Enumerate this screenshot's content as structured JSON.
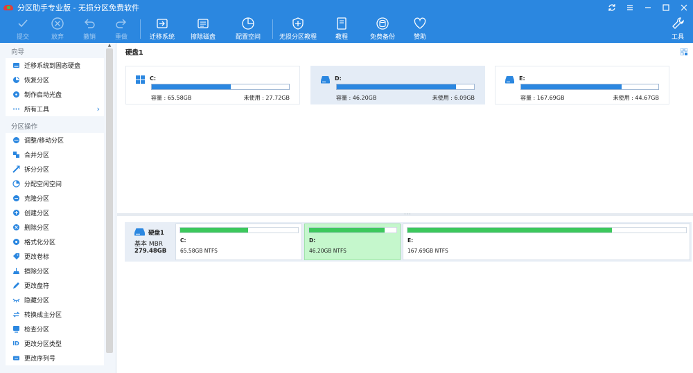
{
  "window": {
    "title": "分区助手专业版 - 无损分区免费软件"
  },
  "toolbar": [
    {
      "id": "commit",
      "label": "提交",
      "icon": "check-icon",
      "enabled": false
    },
    {
      "id": "discard",
      "label": "放弃",
      "icon": "cancel-circle-icon",
      "enabled": false
    },
    {
      "id": "undo",
      "label": "撤销",
      "icon": "undo-icon",
      "enabled": false
    },
    {
      "id": "redo",
      "label": "重做",
      "icon": "redo-icon",
      "enabled": false
    },
    {
      "id": "migrate",
      "label": "迁移系统",
      "icon": "migrate-drive-icon",
      "enabled": true
    },
    {
      "id": "wipe",
      "label": "擦除磁盘",
      "icon": "wipe-disk-icon",
      "enabled": true
    },
    {
      "id": "allocate",
      "label": "配置空间",
      "icon": "pie-chart-icon",
      "enabled": true
    },
    {
      "id": "tutorial-lossless",
      "label": "无损分区教程",
      "icon": "shield-plus-icon",
      "enabled": true
    },
    {
      "id": "tutorial",
      "label": "教程",
      "icon": "book-icon",
      "enabled": true
    },
    {
      "id": "backup",
      "label": "免费备份",
      "icon": "backup-disk-icon",
      "enabled": true
    },
    {
      "id": "donate",
      "label": "赞助",
      "icon": "heart-icon",
      "enabled": true
    },
    {
      "id": "tools",
      "label": "工具",
      "icon": "wrench-icon",
      "enabled": true
    }
  ],
  "sidebar": {
    "wizard_title": "向导",
    "wizard_items": [
      {
        "label": "迁移系统到固态硬盘",
        "icon": "ssd-migrate-icon"
      },
      {
        "label": "恢复分区",
        "icon": "recover-partition-icon"
      },
      {
        "label": "制作启动光盘",
        "icon": "bootable-disc-icon"
      },
      {
        "label": "所有工具",
        "icon": "more-dots-icon",
        "chevron": "›"
      }
    ],
    "ops_title": "分区操作",
    "ops_items": [
      {
        "label": "调整/移动分区",
        "icon": "resize-partition-icon"
      },
      {
        "label": "合并分区",
        "icon": "merge-partition-icon"
      },
      {
        "label": "拆分分区",
        "icon": "split-partition-icon"
      },
      {
        "label": "分配空闲空间",
        "icon": "allocate-space-icon"
      },
      {
        "label": "克隆分区",
        "icon": "clone-partition-icon"
      },
      {
        "label": "创建分区",
        "icon": "create-partition-icon"
      },
      {
        "label": "删除分区",
        "icon": "delete-partition-icon"
      },
      {
        "label": "格式化分区",
        "icon": "format-partition-icon"
      },
      {
        "label": "更改卷标",
        "icon": "tag-icon"
      },
      {
        "label": "擦除分区",
        "icon": "wipe-partition-icon"
      },
      {
        "label": "更改盘符",
        "icon": "pencil-icon"
      },
      {
        "label": "隐藏分区",
        "icon": "hide-eye-icon"
      },
      {
        "label": "转换成主分区",
        "icon": "convert-icon"
      },
      {
        "label": "检查分区",
        "icon": "check-partition-icon"
      },
      {
        "label": "更改分区类型",
        "icon": "id-icon",
        "icon_text": "ID"
      },
      {
        "label": "更改序列号",
        "icon": "serial-number-icon"
      }
    ]
  },
  "disk_panel": {
    "title": "硬盘1",
    "volumes": [
      {
        "name": "C:",
        "capacity": "容量 : 65.58GB",
        "free": "未使用 : 27.72GB",
        "used_fraction": 0.577,
        "selected": false,
        "icon": "windows-logo-icon"
      },
      {
        "name": "D:",
        "capacity": "容量 : 46.20GB",
        "free": "未使用 : 6.09GB",
        "used_fraction": 0.868,
        "selected": true,
        "icon": "drive-icon"
      },
      {
        "name": "E:",
        "capacity": "容量 : 167.69GB",
        "free": "未使用 : 44.67GB",
        "used_fraction": 0.734,
        "selected": false,
        "icon": "drive-icon"
      }
    ]
  },
  "disk_map": {
    "disk_name": "硬盘1",
    "disk_type": "基本 MBR",
    "disk_size": "279.48GB",
    "partitions": [
      {
        "name": "C:",
        "desc": "65.58GB NTFS",
        "used_fraction": 0.577,
        "selected": false
      },
      {
        "name": "D:",
        "desc": "46.20GB NTFS",
        "used_fraction": 0.868,
        "selected": true
      },
      {
        "name": "E:",
        "desc": "167.69GB NTFS",
        "used_fraction": 0.734,
        "selected": false
      }
    ]
  },
  "colors": {
    "accent": "#2b87e0",
    "used_bar": "#2b87e0",
    "map_used_bar": "#3cc85c",
    "selected_partition": "#c5f7cc"
  }
}
